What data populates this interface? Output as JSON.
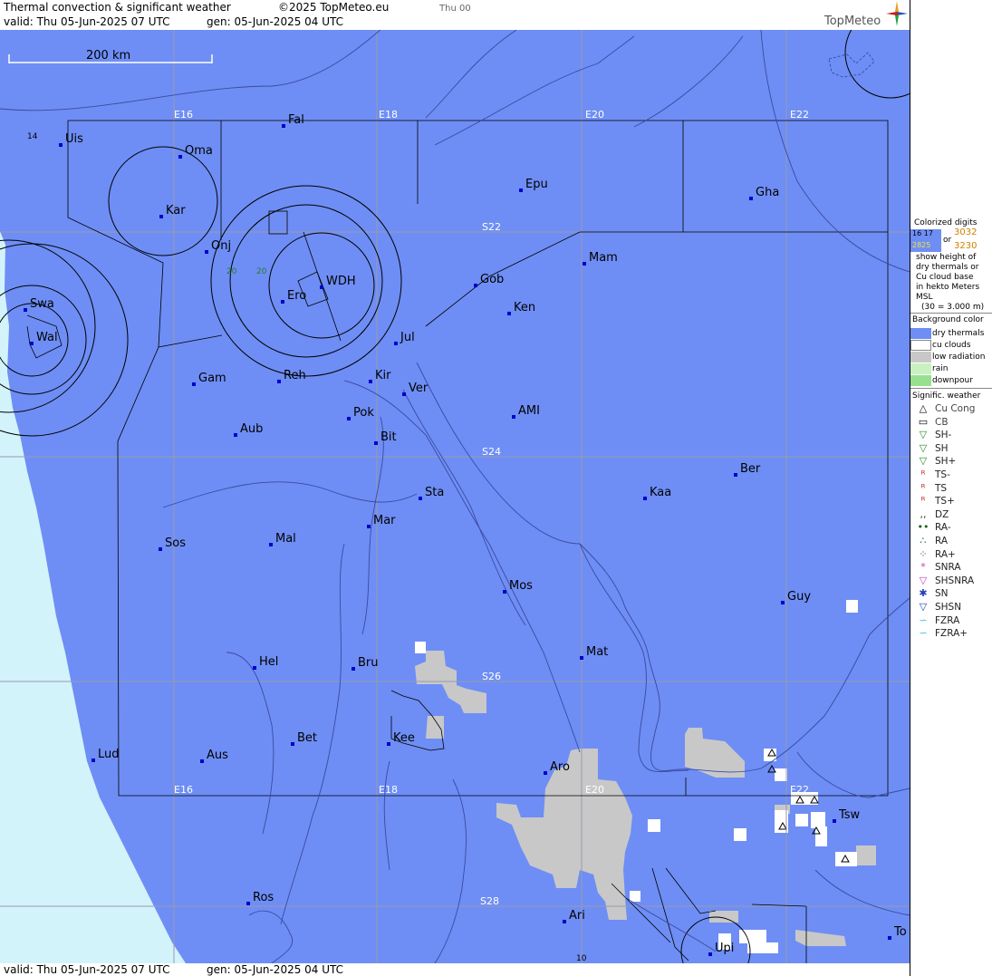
{
  "header": {
    "title": "Thermal convection & significant weather",
    "copyright": "©2025 TopMeteo.eu",
    "tab_day": "Thu 00",
    "valid": "valid:  Thu  05-Jun-2025  07 UTC",
    "generated": "gen: 05-Jun-2025 04 UTC",
    "logo": "TopMeteo"
  },
  "footer": {
    "valid": "valid:  Thu  05-Jun-2025  07 UTC",
    "generated": "gen: 05-Jun-2025 04 UTC"
  },
  "scale_bar": {
    "label": "200 km"
  },
  "grid_labels": {
    "E16": "E16",
    "E18": "E18",
    "E20": "E20",
    "E22": "E22",
    "S22": "S22",
    "S24": "S24",
    "S26": "S26",
    "S28": "S28"
  },
  "thermal_digits": {
    "d14": "14",
    "d20a": "20",
    "d20b": "20",
    "d10": "10"
  },
  "cities": [
    {
      "name": "Uis"
    },
    {
      "name": "Fal"
    },
    {
      "name": "Oma"
    },
    {
      "name": "Kar"
    },
    {
      "name": "Epu"
    },
    {
      "name": "Gha"
    },
    {
      "name": "Onj"
    },
    {
      "name": "Mam"
    },
    {
      "name": "Gob"
    },
    {
      "name": "WDH"
    },
    {
      "name": "Ero"
    },
    {
      "name": "Ken"
    },
    {
      "name": "Swa"
    },
    {
      "name": "Wal"
    },
    {
      "name": "Jul"
    },
    {
      "name": "Gam"
    },
    {
      "name": "Reh"
    },
    {
      "name": "Kir"
    },
    {
      "name": "Ver"
    },
    {
      "name": "AMI"
    },
    {
      "name": "Pok"
    },
    {
      "name": "Aub"
    },
    {
      "name": "Bit"
    },
    {
      "name": "Ber"
    },
    {
      "name": "Sta"
    },
    {
      "name": "Kaa"
    },
    {
      "name": "Mar"
    },
    {
      "name": "Sos"
    },
    {
      "name": "Mal"
    },
    {
      "name": "Mos"
    },
    {
      "name": "Guy"
    },
    {
      "name": "Mat"
    },
    {
      "name": "Hel"
    },
    {
      "name": "Bru"
    },
    {
      "name": "Bet"
    },
    {
      "name": "Kee"
    },
    {
      "name": "Lud"
    },
    {
      "name": "Aus"
    },
    {
      "name": "Aro"
    },
    {
      "name": "Tsw"
    },
    {
      "name": "Ros"
    },
    {
      "name": "Ari"
    },
    {
      "name": "Upi"
    },
    {
      "name": "To"
    }
  ],
  "legend": {
    "colorized_title": "Colorized digits",
    "digits_a": "16  17",
    "digits_b": "3032",
    "digits_c": "2825",
    "digits_or": "or",
    "digits_d": "3230",
    "desc1": "show height of",
    "desc2": "dry thermals or",
    "desc3": "Cu cloud base",
    "desc4": "in hekto Meters",
    "desc5": "MSL",
    "desc6": "(30 = 3.000 m)",
    "bg_title": "Background color",
    "bg_items": [
      {
        "label": "dry thermals",
        "color": "#6e8ef5"
      },
      {
        "label": "cu clouds",
        "color": "#ffffff"
      },
      {
        "label": "low radiation",
        "color": "#c8c8c8"
      },
      {
        "label": "rain",
        "color": "#c8f0c0"
      },
      {
        "label": "downpour",
        "color": "#98e090"
      }
    ],
    "wx_title": "Signific. weather",
    "wx_items": [
      {
        "label": "Cu Cong",
        "symbol": "△",
        "color": "#000000"
      },
      {
        "label": "CB",
        "symbol": "▭",
        "color": "#000000"
      },
      {
        "label": "SH-",
        "symbol": "▽",
        "color": "#2a8a2a"
      },
      {
        "label": "SH",
        "symbol": "▽",
        "color": "#2a8a2a"
      },
      {
        "label": "SH+",
        "symbol": "▽",
        "color": "#2a8a2a"
      },
      {
        "label": "TS-",
        "symbol": "ᴿ",
        "color": "#c02020"
      },
      {
        "label": "TS",
        "symbol": "ᴿ",
        "color": "#c02020"
      },
      {
        "label": "TS+",
        "symbol": "ᴿ",
        "color": "#c02020"
      },
      {
        "label": "DZ",
        "symbol": ",,",
        "color": "#1a5a1a"
      },
      {
        "label": "RA-",
        "symbol": "••",
        "color": "#1a5a1a"
      },
      {
        "label": "RA",
        "symbol": "∴",
        "color": "#1a5a1a"
      },
      {
        "label": "RA+",
        "symbol": "⁘",
        "color": "#1a5a1a"
      },
      {
        "label": "SNRA",
        "symbol": "*",
        "color": "#c040c0"
      },
      {
        "label": "SHSNRA",
        "symbol": "▽",
        "color": "#c040c0"
      },
      {
        "label": "SN",
        "symbol": "✱",
        "color": "#2040c0"
      },
      {
        "label": "SHSN",
        "symbol": "▽",
        "color": "#2040c0"
      },
      {
        "label": "FZRA",
        "symbol": "∽",
        "color": "#40c0e0"
      },
      {
        "label": "FZRA+",
        "symbol": "∽",
        "color": "#40c0e0"
      }
    ]
  },
  "colors": {
    "dry_thermals": "#6e8ef5",
    "ocean": "#d3f3fb",
    "low_radiation": "#c8c8c8",
    "grid": "#9a9ab0",
    "city_dot": "#0000cc"
  }
}
